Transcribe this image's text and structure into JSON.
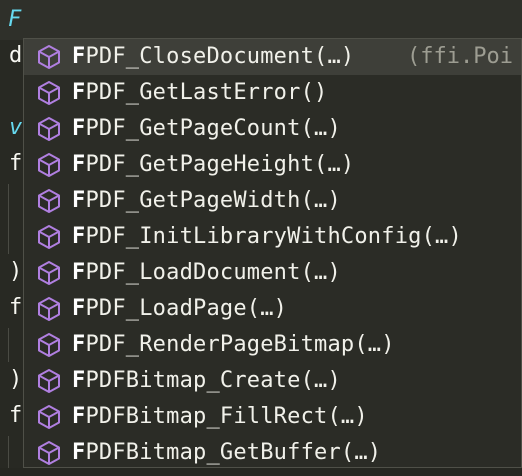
{
  "editor": {
    "typed_text": "F",
    "gutter_glyphs": [
      "d",
      "v",
      "f",
      ")",
      "f",
      ")",
      "f"
    ]
  },
  "autocomplete": {
    "selected_index": 0,
    "detail": "(ffi.Poi",
    "icon": "method-cube-icon",
    "icon_color": "#b07fe0",
    "items": [
      {
        "match": "F",
        "rest": "PDF_CloseDocument(…)"
      },
      {
        "match": "F",
        "rest": "PDF_GetLastError()"
      },
      {
        "match": "F",
        "rest": "PDF_GetPageCount(…)"
      },
      {
        "match": "F",
        "rest": "PDF_GetPageHeight(…)"
      },
      {
        "match": "F",
        "rest": "PDF_GetPageWidth(…)"
      },
      {
        "match": "F",
        "rest": "PDF_InitLibraryWithConfig(…)"
      },
      {
        "match": "F",
        "rest": "PDF_LoadDocument(…)"
      },
      {
        "match": "F",
        "rest": "PDF_LoadPage(…)"
      },
      {
        "match": "F",
        "rest": "PDF_RenderPageBitmap(…)"
      },
      {
        "match": "F",
        "rest": "PDFBitmap_Create(…)"
      },
      {
        "match": "F",
        "rest": "PDFBitmap_FillRect(…)"
      },
      {
        "match": "F",
        "rest": "PDFBitmap_GetBuffer(…)"
      }
    ]
  }
}
